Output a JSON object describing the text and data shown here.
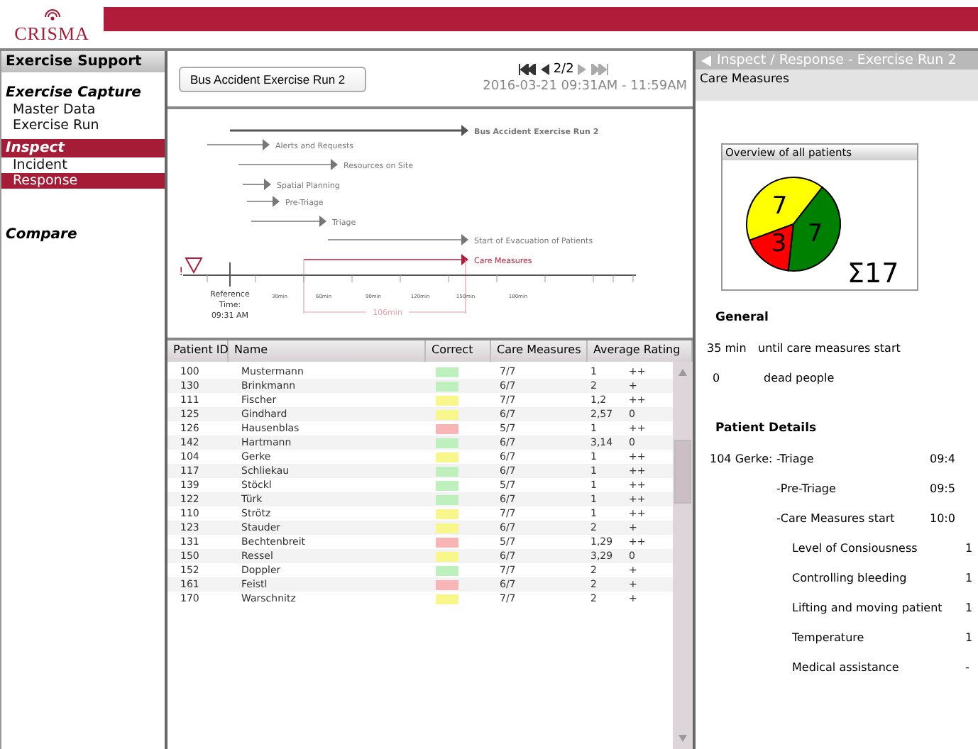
{
  "logo": {
    "text": "CRISMA"
  },
  "sidebar": {
    "title": "Exercise Support",
    "sections": [
      {
        "title": "Exercise Capture",
        "selected": false,
        "items": [
          {
            "label": "Master Data",
            "selected": false
          },
          {
            "label": "Exercise Run",
            "selected": false
          }
        ]
      },
      {
        "title": "Inspect",
        "selected": true,
        "items": [
          {
            "label": "Incident",
            "selected": false
          },
          {
            "label": "Response",
            "selected": true
          }
        ]
      },
      {
        "title": "Compare",
        "selected": false
      }
    ]
  },
  "run_selector": {
    "value": "Bus Accident Exercise Run 2"
  },
  "navigation": {
    "page": "2/2",
    "date_range": "2016-03-21  09:31AM - 11:59AM"
  },
  "timeline": {
    "phases": [
      {
        "label": "Bus Accident Exercise Run 2",
        "kind": "main"
      },
      {
        "label": "Alerts and Requests",
        "kind": "phase"
      },
      {
        "label": "Resources on Site",
        "kind": "phase"
      },
      {
        "label": "Spatial Planning",
        "kind": "phase"
      },
      {
        "label": "Pre-Triage",
        "kind": "phase"
      },
      {
        "label": "Triage",
        "kind": "phase"
      },
      {
        "label": "Start of Evacuation of Patients",
        "kind": "phase"
      },
      {
        "label": "Care Measures",
        "kind": "highlight"
      }
    ],
    "warning": "!",
    "reference": [
      "Reference",
      "Time:",
      "09:31 AM"
    ],
    "ticks": [
      "30min",
      "60min",
      "90min",
      "120min",
      "150min",
      "180min"
    ],
    "duration": "106min"
  },
  "table": {
    "columns": [
      "Patient ID",
      "Name",
      "Correct",
      "Care Measures",
      "Average Rating"
    ],
    "rows": [
      {
        "id": "100",
        "name": "Mustermann",
        "color": "#bdf0bd",
        "care": "7/7",
        "rating": "1",
        "grade": "++"
      },
      {
        "id": "130",
        "name": "Brinkmann",
        "color": "#bdf0bd",
        "care": "6/7",
        "rating": "2",
        "grade": "+"
      },
      {
        "id": "111",
        "name": "Fischer",
        "color": "#f7f78c",
        "care": "7/7",
        "rating": "1,2",
        "grade": "++"
      },
      {
        "id": "125",
        "name": "Gindhard",
        "color": "#f7f78c",
        "care": "6/7",
        "rating": "2,57",
        "grade": "0"
      },
      {
        "id": "126",
        "name": "Hausenblas",
        "color": "#f7b5b5",
        "care": "5/7",
        "rating": "1",
        "grade": "++"
      },
      {
        "id": "142",
        "name": "Hartmann",
        "color": "#bdf0bd",
        "care": "6/7",
        "rating": "3,14",
        "grade": "0"
      },
      {
        "id": "104",
        "name": "Gerke",
        "color": "#f7f78c",
        "care": "6/7",
        "rating": "1",
        "grade": "++"
      },
      {
        "id": "117",
        "name": "Schliekau",
        "color": "#bdf0bd",
        "care": "6/7",
        "rating": "1",
        "grade": "++"
      },
      {
        "id": "139",
        "name": "Stöckl",
        "color": "#bdf0bd",
        "care": "5/7",
        "rating": "1",
        "grade": "++"
      },
      {
        "id": "122",
        "name": "Türk",
        "color": "#bdf0bd",
        "care": "6/7",
        "rating": "1",
        "grade": "++"
      },
      {
        "id": "110",
        "name": "Strötz",
        "color": "#f7f78c",
        "care": "7/7",
        "rating": "1",
        "grade": "++"
      },
      {
        "id": "123",
        "name": "Stauder",
        "color": "#f7f78c",
        "care": "6/7",
        "rating": "2",
        "grade": "+"
      },
      {
        "id": "131",
        "name": "Bechtenbreit",
        "color": "#f7b5b5",
        "care": "5/7",
        "rating": "1,29",
        "grade": "++"
      },
      {
        "id": "150",
        "name": "Ressel",
        "color": "#f7f78c",
        "care": "6/7",
        "rating": "3,29",
        "grade": "0"
      },
      {
        "id": "152",
        "name": "Doppler",
        "color": "#bdf0bd",
        "care": "7/7",
        "rating": "2",
        "grade": "+"
      },
      {
        "id": "161",
        "name": "Feistl",
        "color": "#f7b5b5",
        "care": "6/7",
        "rating": "2",
        "grade": "+"
      },
      {
        "id": "170",
        "name": "Warschnitz",
        "color": "#f7f78c",
        "care": "7/7",
        "rating": "2",
        "grade": "+"
      }
    ]
  },
  "details": {
    "breadcrumb": "Inspect / Response - Exercise Run 2",
    "subtitle": "Care Measures",
    "overview": {
      "title": "Overview of all patients",
      "chart_data": {
        "type": "pie",
        "values": [
          7,
          3,
          7
        ],
        "colors": [
          "#ffff00",
          "#ff0000",
          "#008000"
        ],
        "data_labels": true
      },
      "total": "Σ17"
    },
    "general": {
      "title": "General",
      "rows": [
        {
          "value": "35 min",
          "label": "until care measures start"
        },
        {
          "value": "0",
          "label": "dead people"
        }
      ]
    },
    "patient": {
      "title": "Patient Details",
      "name": "104 Gerke:",
      "events": [
        {
          "label": "-Triage",
          "time": "09:4"
        },
        {
          "label": "-Pre-Triage",
          "time": "09:5"
        },
        {
          "label": "-Care Measures start",
          "time": "10:0"
        }
      ],
      "measures": [
        {
          "label": "Level of Consiousness",
          "value": "1"
        },
        {
          "label": "Controlling bleeding",
          "value": "1"
        },
        {
          "label": "Lifting and moving patient",
          "value": "1"
        },
        {
          "label": "Temperature",
          "value": "1"
        },
        {
          "label": "Medical assistance",
          "value": "-"
        }
      ]
    }
  }
}
